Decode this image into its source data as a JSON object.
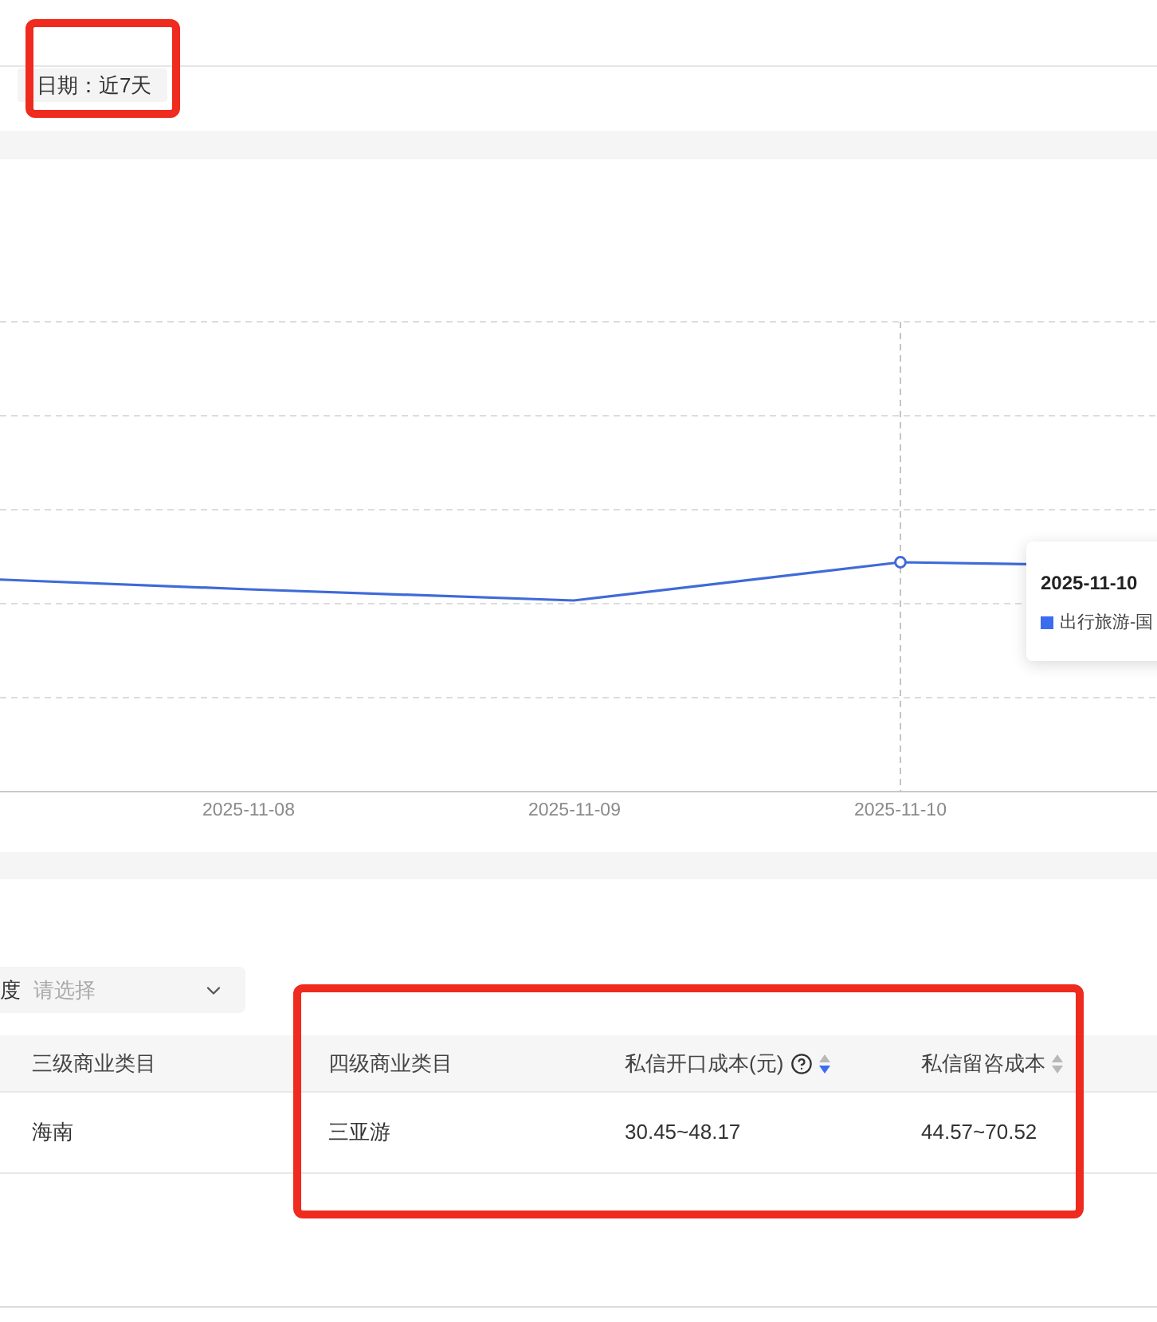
{
  "filter": {
    "label": "日期：近7天",
    "highlighted": true
  },
  "chart": {
    "x_labels": [
      {
        "label": "2025-11-08"
      },
      {
        "label": "2025-11-09"
      },
      {
        "label": "2025-11-10",
        "tooltip": {
          "title": "2025-11-10",
          "series": "出行旅游-国"
        }
      }
    ]
  },
  "dimension_select": {
    "label": "度",
    "placeholder": "请选择"
  },
  "table": {
    "highlighted": true,
    "columns": [
      {
        "label": "三级商业类目"
      },
      {
        "label": "四级商业类目"
      },
      {
        "label": "私信开口成本(元)",
        "help": true,
        "sort_descending": true
      },
      {
        "label": "私信留咨成本",
        "sort_descending": false
      }
    ],
    "rows": [
      {
        "cells": [
          "海南",
          "三亚游",
          "30.45~48.17",
          "44.57~70.52"
        ]
      }
    ]
  }
}
